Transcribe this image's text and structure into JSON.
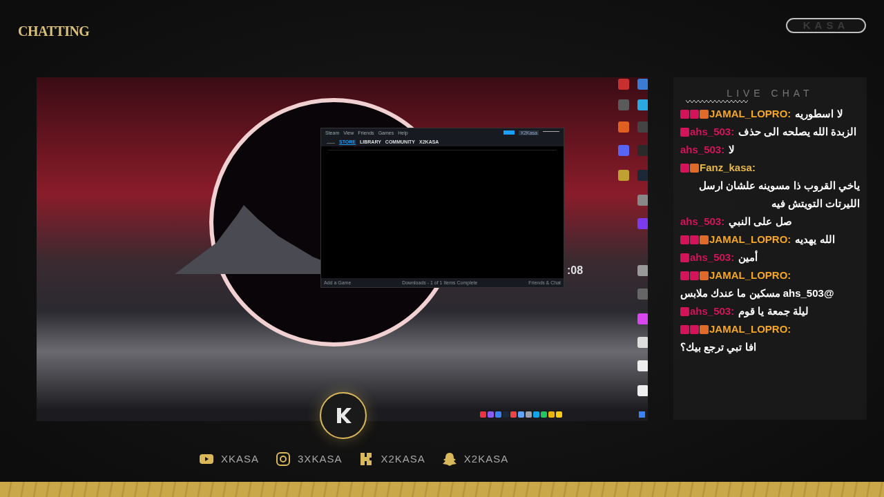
{
  "header": {
    "title": "CHATTING",
    "logo": "KASA"
  },
  "desktop": {
    "clock_partial": ":08",
    "steam": {
      "menu": [
        "Steam",
        "View",
        "Friends",
        "Games",
        "Help"
      ],
      "tabs": [
        {
          "label": "STORE",
          "selected": true
        },
        {
          "label": "LIBRARY",
          "selected": false
        },
        {
          "label": "COMMUNITY",
          "selected": false
        },
        {
          "label": "X2KASA",
          "selected": false
        }
      ],
      "account": "X2Kasa",
      "footer": [
        "Add a Game",
        "Downloads - 1 of 1 Items Complete",
        "Friends & Chat"
      ]
    }
  },
  "chat": {
    "title": "LIVE CHAT",
    "messages": [
      {
        "pen": true,
        "gem": true,
        "og": true,
        "user": "JAMAL_LOPRO:",
        "color": "#f5a623",
        "text": "لا اسطوريه"
      },
      {
        "pen": true,
        "gem": false,
        "og": false,
        "user": "ahs_503:",
        "color": "#d4145a",
        "text": "الزبدة الله يصلحه الى حذف"
      },
      {
        "pen": false,
        "gem": false,
        "og": false,
        "user": "ahs_503:",
        "color": "#d4145a",
        "text": "لا"
      },
      {
        "pen": true,
        "gem": false,
        "og": true,
        "user": "Fanz_kasa:",
        "color": "#e6b84a",
        "text": "ياخي القروب ذا مسوينه علشان ارسل الليرتات التويتش فيه"
      },
      {
        "pen": false,
        "gem": false,
        "og": false,
        "user": "ahs_503:",
        "color": "#d4145a",
        "text": "صل على النبي"
      },
      {
        "pen": true,
        "gem": true,
        "og": true,
        "user": "JAMAL_LOPRO:",
        "color": "#f5a623",
        "text": "الله يهديه"
      },
      {
        "pen": true,
        "gem": false,
        "og": false,
        "user": "ahs_503:",
        "color": "#d4145a",
        "text": "أمين"
      },
      {
        "pen": true,
        "gem": true,
        "og": true,
        "user": "JAMAL_LOPRO:",
        "color": "#f5a623",
        "text": "@ahs_503 مسكين ما عندك ملابس"
      },
      {
        "pen": true,
        "gem": false,
        "og": false,
        "user": "ahs_503:",
        "color": "#d4145a",
        "text": "ليلة جمعة يا قوم"
      },
      {
        "pen": true,
        "gem": true,
        "og": true,
        "user": "JAMAL_LOPRO:",
        "color": "#f5a623",
        "text": "افا تبي ترجع بيك؟"
      }
    ]
  },
  "socials": [
    {
      "kind": "youtube",
      "handle": "XKASA"
    },
    {
      "kind": "instagram",
      "handle": "3XKASA"
    },
    {
      "kind": "kick",
      "handle": "X2KASA"
    },
    {
      "kind": "snapchat",
      "handle": "X2KASA"
    }
  ]
}
